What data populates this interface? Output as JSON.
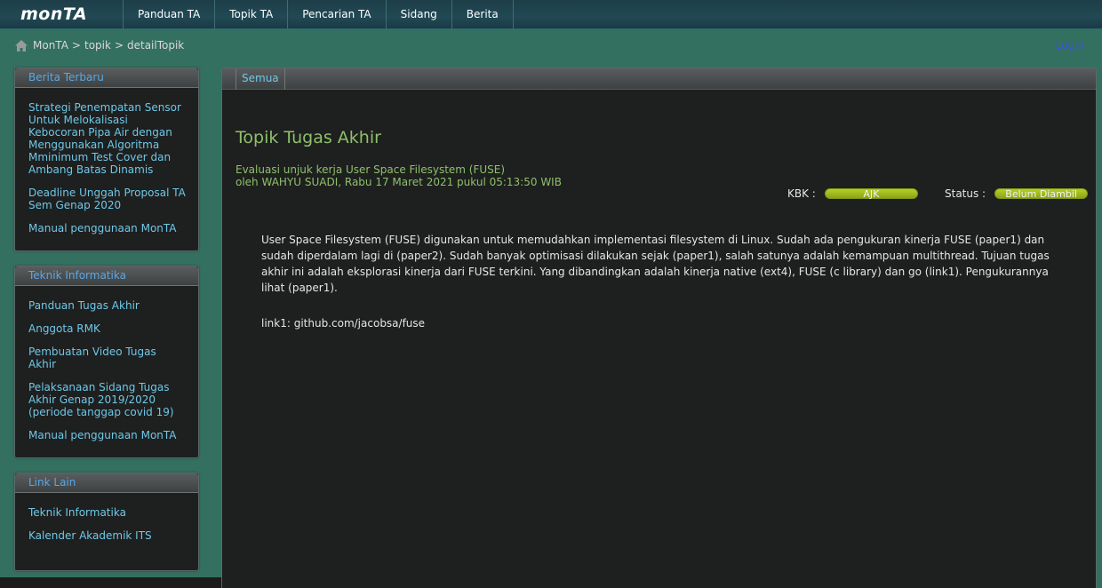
{
  "app": {
    "logo": "monTA"
  },
  "nav": [
    "Panduan TA",
    "Topik TA",
    "Pencarian TA",
    "Sidang",
    "Berita"
  ],
  "breadcrumb": {
    "home": "MonTA",
    "sep": ">",
    "items": [
      "topik",
      "detailTopik"
    ]
  },
  "login": "Login",
  "sidebar": {
    "berita": {
      "title": "Berita Terbaru",
      "items": [
        "Strategi Penempatan Sensor Untuk Melokalisasi Kebocoran Pipa Air dengan Menggunakan Algoritma Mminimum Test Cover dan Ambang Batas Dinamis",
        "Deadline Unggah Proposal TA Sem Genap 2020",
        "Manual penggunaan MonTA"
      ]
    },
    "ti": {
      "title": "Teknik Informatika",
      "items": [
        "Panduan Tugas Akhir",
        "Anggota RMK",
        "Pembuatan Video Tugas Akhir",
        "Pelaksanaan Sidang Tugas Akhir Genap 2019/2020 (periode tanggap covid 19)",
        "Manual penggunaan MonTA"
      ]
    },
    "link": {
      "title": "Link Lain",
      "items": [
        "Teknik Informatika",
        "Kalender Akademik ITS"
      ]
    }
  },
  "main": {
    "tab": "Semua",
    "title": "Topik Tugas Akhir",
    "topic": "Evaluasi unjuk kerja User Space Filesystem (FUSE)",
    "meta": "oleh WAHYU SUADI, Rabu 17 Maret 2021 pukul 05:13:50 WIB",
    "kbk_label": "KBK :",
    "kbk_value": "AJK",
    "status_label": "Status :",
    "status_value": "Belum Diambil",
    "description": "User Space Filesystem (FUSE) digunakan untuk memudahkan implementasi filesystem di Linux. Sudah ada pengukuran kinerja FUSE (paper1) dan sudah diperdalam lagi di (paper2). Sudah banyak optimisasi dilakukan sejak (paper1), salah satunya adalah kemampuan multithread. Tujuan tugas akhir ini adalah eksplorasi kinerja dari FUSE terkini. Yang dibandingkan adalah kinerja native (ext4), FUSE (c library) dan go (link1). Pengukurannya lihat (paper1).",
    "link1": "link1: github.com/jacobsa/fuse"
  },
  "colors": {
    "accent": "#8ec06a",
    "link": "#6ec8e8",
    "pill": "#a3bd20",
    "bg": "#33705f"
  }
}
